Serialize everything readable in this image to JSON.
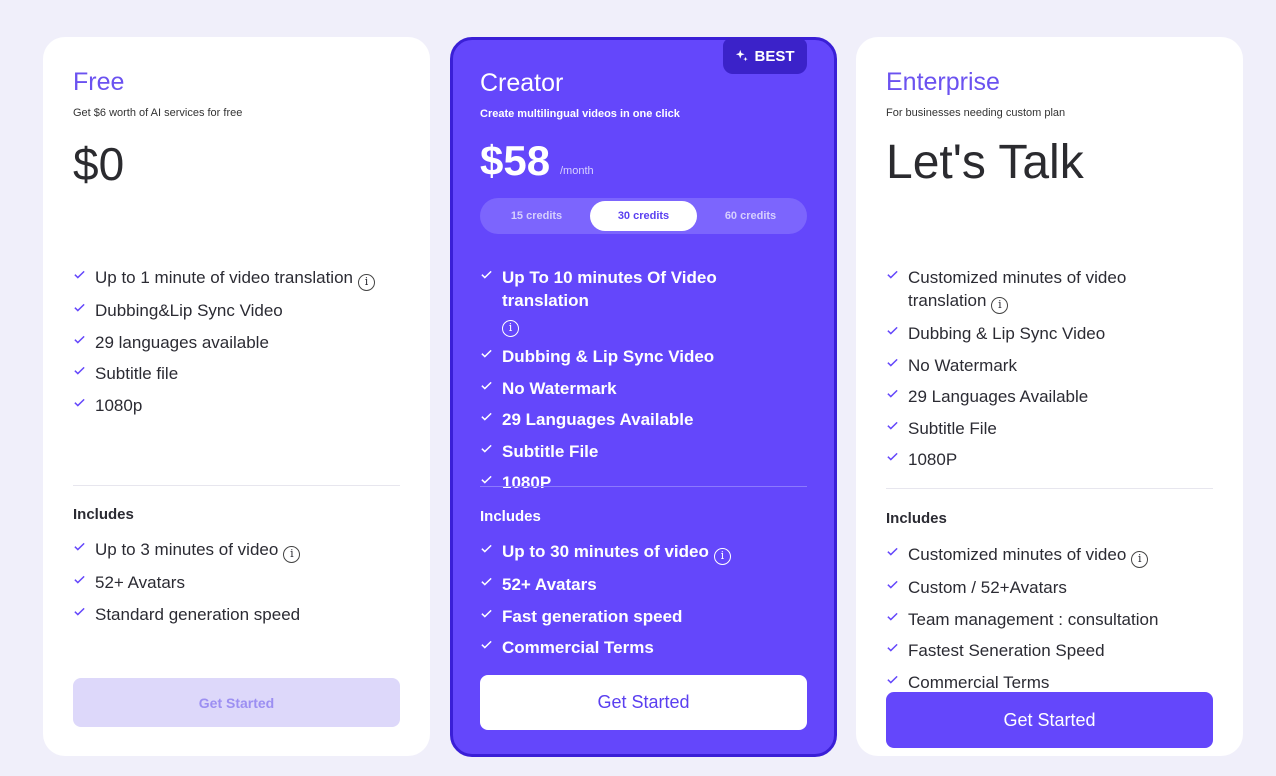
{
  "colors": {
    "accent": "#6447fb",
    "page_bg": "#f0effa",
    "badge": "#3b22c9"
  },
  "free": {
    "name": "Free",
    "subtitle": "Get $6 worth of AI services for free",
    "price": "$0",
    "features": [
      "Up to 1 minute of video translation",
      "Dubbing&Lip Sync Video",
      "29 languages available",
      "Subtitle file",
      "1080p"
    ],
    "includes_label": "Includes",
    "includes": [
      "Up to 3 minutes of video",
      "52+ Avatars",
      "Standard generation speed"
    ],
    "cta": "Get Started"
  },
  "creator": {
    "badge": "BEST",
    "name": "Creator",
    "subtitle": "Create multilingual videos in one click",
    "price": "$58",
    "period": "/month",
    "credit_options": [
      "15 credits",
      "30 credits",
      "60 credits"
    ],
    "credit_selected": "30 credits",
    "features": [
      "Up To 10 minutes Of Video translation",
      "Dubbing & Lip Sync Video",
      "No Watermark",
      "29 Languages Available",
      "Subtitle File",
      "1080P"
    ],
    "includes_label": "Includes",
    "includes": [
      "Up to 30 minutes of video",
      "52+ Avatars",
      "Fast generation speed",
      "Commercial Terms"
    ],
    "cta": "Get Started"
  },
  "enterprise": {
    "name": "Enterprise",
    "subtitle": "For businesses needing custom plan",
    "price": "Let's Talk",
    "features": [
      "Customized minutes of video translation",
      "Dubbing & Lip Sync Video",
      "No Watermark",
      "29 Languages Available",
      "Subtitle File",
      "1080P"
    ],
    "includes_label": "Includes",
    "includes": [
      "Customized minutes of video",
      "Custom / 52+Avatars",
      "Team management : consultation",
      "Fastest Seneration Speed",
      "Commercial Terms"
    ],
    "cta": "Get Started"
  },
  "icons": {
    "check": "check-icon",
    "info": "info-icon",
    "sparkle": "sparkle-icon"
  }
}
